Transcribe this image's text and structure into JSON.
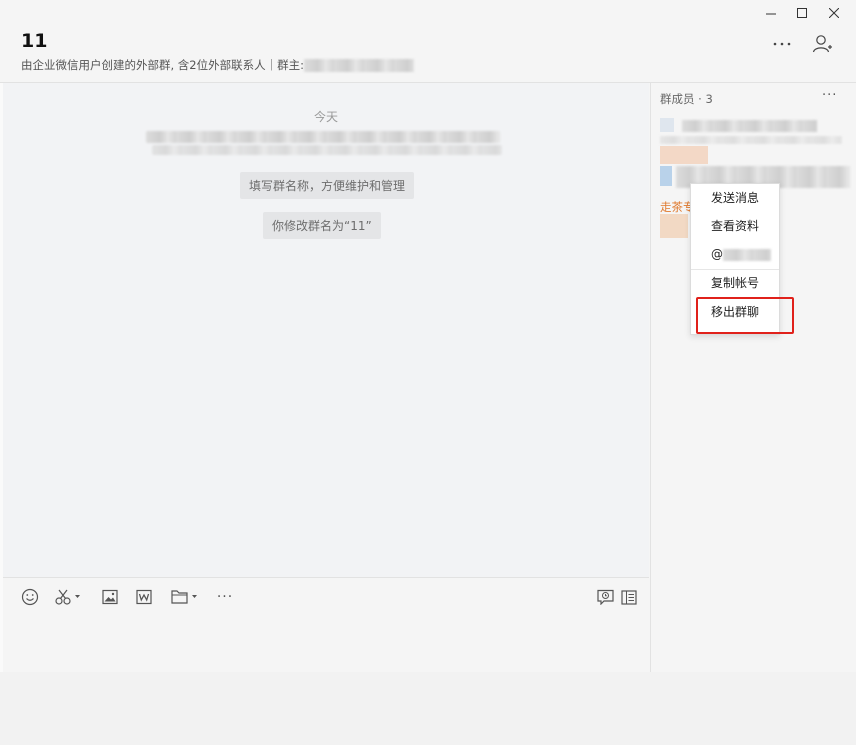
{
  "window": {
    "controls": [
      "minimize-icon",
      "maximize-icon",
      "close-icon"
    ]
  },
  "header": {
    "title": "11",
    "subtitle": "由企业微信用户创建的外部群, 含2位外部联系人｜群主:",
    "icons": [
      "more-icon",
      "add-member-icon"
    ]
  },
  "chat": {
    "date_label": "今天",
    "system_messages": [
      "填写群名称，方便维护和管理",
      "你修改群名为“11”"
    ]
  },
  "members": {
    "title": "群成员 · 3",
    "more_label": "···",
    "member_3_label_partial": "走茶专"
  },
  "context_menu": {
    "items": [
      {
        "label": "发送消息"
      },
      {
        "label": "查看资料"
      },
      {
        "label": "@"
      },
      {
        "label": "复制帐号"
      },
      {
        "label": "移出群聊"
      }
    ],
    "highlight_color": "#e0211b"
  },
  "toolbar": {
    "icons": [
      "emoji-icon",
      "screenshot-icon",
      "image-icon",
      "word-doc-icon",
      "folder-icon",
      "more-icon",
      "chat-history-icon",
      "sidebar-toggle-icon"
    ],
    "more_label": "···"
  },
  "colors": {
    "accent_orange": "#e07a2e",
    "highlight_red": "#e0211b"
  }
}
